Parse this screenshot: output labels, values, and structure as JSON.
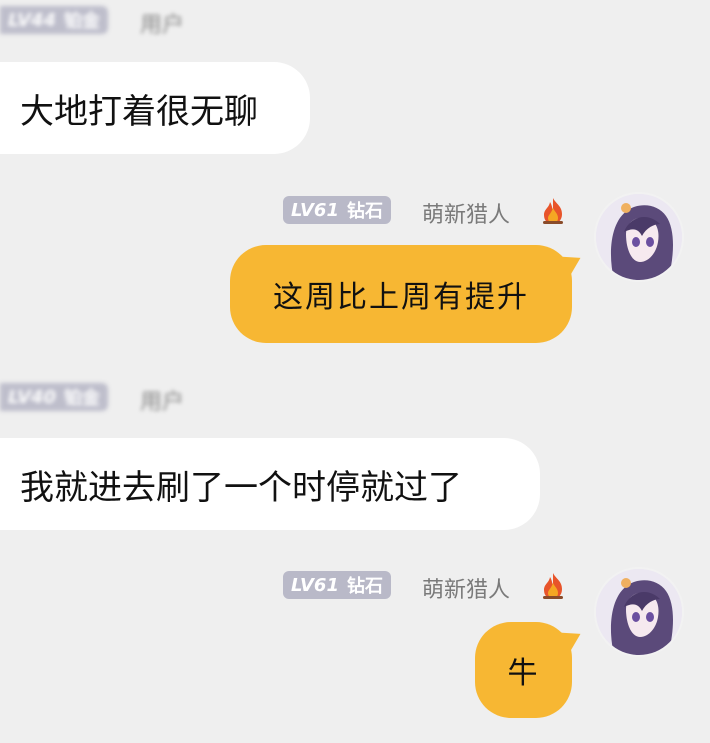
{
  "messages": [
    {
      "side": "left",
      "level": "LV44",
      "rank": "铂金",
      "name": "用户",
      "text": "大地打着很无聊"
    },
    {
      "side": "right",
      "level": "LV61",
      "rank": "钻石",
      "name": "萌新猎人",
      "text": "这周比上周有提升"
    },
    {
      "side": "left",
      "level": "LV40",
      "rank": "铂金",
      "name": "用户",
      "text": "我就进去刷了一个时停就过了"
    },
    {
      "side": "right",
      "level": "LV61",
      "rank": "钻石",
      "name": "萌新猎人",
      "text": "牛"
    }
  ],
  "icons": {
    "fire": "fire-emoji-icon",
    "avatar": "anime-girl-avatar"
  },
  "colors": {
    "background": "#efefef",
    "left_bubble": "#ffffff",
    "right_bubble": "#f7b733",
    "badge": "#b9b9c8"
  }
}
